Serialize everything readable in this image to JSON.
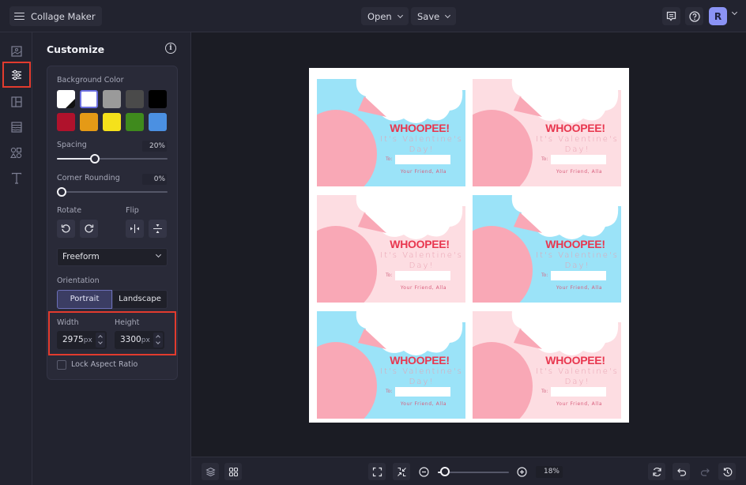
{
  "topbar": {
    "app_title": "Collage Maker",
    "menu_icon": "hamburger-icon",
    "open_label": "Open",
    "save_label": "Save",
    "feedback_icon": "comment-icon",
    "help_icon": "help-circle-icon",
    "avatar_initial": "R",
    "avatar_color": "#8b93f5"
  },
  "rail": {
    "items": [
      {
        "name": "images",
        "icon": "image-icon",
        "active": false
      },
      {
        "name": "customize",
        "icon": "sliders-icon",
        "active": true
      },
      {
        "name": "layouts",
        "icon": "layout-icon",
        "active": false
      },
      {
        "name": "backgrounds",
        "icon": "texture-icon",
        "active": false
      },
      {
        "name": "graphics",
        "icon": "shapes-icon",
        "active": false
      },
      {
        "name": "text",
        "icon": "text-icon",
        "active": false
      }
    ]
  },
  "panel": {
    "title": "Customize",
    "background_color_label": "Background Color",
    "swatches": [
      "transparent",
      "#ffffff",
      "#9a9a9a",
      "#4a4a4a",
      "#000000",
      "#b0122c",
      "#e59a16",
      "#f5e11b",
      "#3f8a1d",
      "#4b90e2"
    ],
    "selected_swatch_index": 1,
    "spacing_label": "Spacing",
    "spacing_value": "20%",
    "spacing_fraction": 0.2,
    "corner_rounding_label": "Corner Rounding",
    "corner_rounding_value": "0%",
    "corner_rounding_fraction": 0,
    "rotate_label": "Rotate",
    "flip_label": "Flip",
    "aspect_select": "Freeform",
    "orientation_label": "Orientation",
    "orientation_options": [
      "Portrait",
      "Landscape"
    ],
    "orientation_selected": "Portrait",
    "width_label": "Width",
    "width_value": "2975",
    "height_label": "Height",
    "height_value": "3300",
    "unit": "px",
    "lock_aspect_label": "Lock Aspect Ratio",
    "lock_aspect_checked": false
  },
  "canvas": {
    "cards": [
      {
        "theme": "blue",
        "bg": "#9be3f8",
        "headline": "WHOOPEE!",
        "line1": "It's Valentine's",
        "line2": "Day!",
        "to_label": "To:",
        "signoff": "Your Friend, Alla"
      },
      {
        "theme": "pink",
        "bg": "#fddde2",
        "headline": "WHOOPEE!",
        "line1": "It's Valentine's",
        "line2": "Day!",
        "to_label": "To:",
        "signoff": "Your Friend, Alla"
      },
      {
        "theme": "pink",
        "bg": "#fddde2",
        "headline": "WHOOPEE!",
        "line1": "It's Valentine's",
        "line2": "Day!",
        "to_label": "To:",
        "signoff": "Your Friend, Alla"
      },
      {
        "theme": "blue",
        "bg": "#9be3f8",
        "headline": "WHOOPEE!",
        "line1": "It's Valentine's",
        "line2": "Day!",
        "to_label": "To:",
        "signoff": "Your Friend, Alla"
      },
      {
        "theme": "blue",
        "bg": "#9be3f8",
        "headline": "WHOOPEE!",
        "line1": "It's Valentine's",
        "line2": "Day!",
        "to_label": "To:",
        "signoff": "Your Friend, Alla"
      },
      {
        "theme": "pink",
        "bg": "#fddde2",
        "headline": "WHOOPEE!",
        "line1": "It's Valentine's",
        "line2": "Day!",
        "to_label": "To:",
        "signoff": "Your Friend, Alla"
      }
    ],
    "balloon_color": "#f9a8b6"
  },
  "bottombar": {
    "zoom_value": "18%",
    "zoom_fraction": 0.05
  },
  "colors": {
    "highlight": "#e23b2e",
    "accent": "#6b6fb8"
  }
}
